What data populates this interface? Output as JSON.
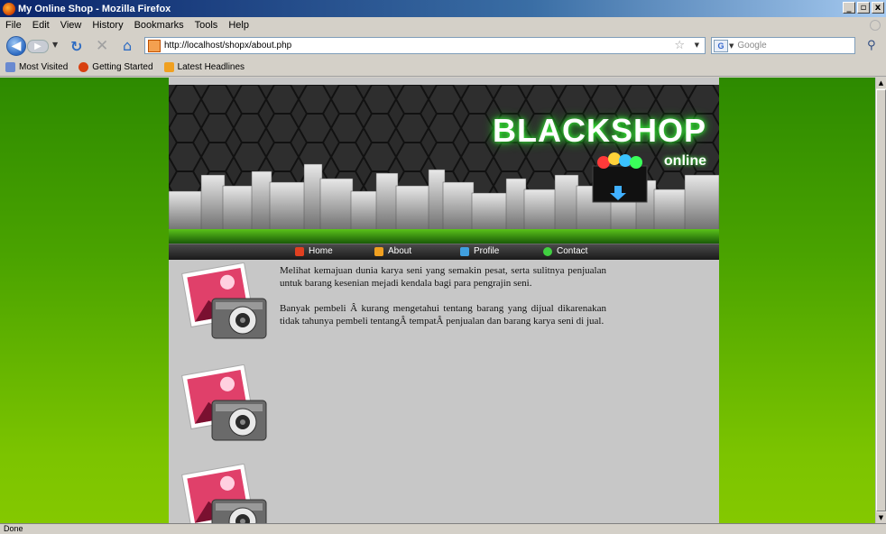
{
  "window": {
    "title": "My Online Shop - Mozilla Firefox",
    "controls": [
      "_",
      "▫",
      "x"
    ]
  },
  "menubar": [
    "File",
    "Edit",
    "View",
    "History",
    "Bookmarks",
    "Tools",
    "Help"
  ],
  "toolbar": {
    "url": "http://localhost/shopx/about.php",
    "search_placeholder": "Google",
    "search_engine": "G"
  },
  "bookmarks": [
    {
      "label": "Most Visited",
      "icon": "most-visited-icon",
      "color": "#6a8ad0"
    },
    {
      "label": "Getting Started",
      "icon": "firefox-icon",
      "color": "#d84010"
    },
    {
      "label": "Latest Headlines",
      "icon": "rss-icon",
      "color": "#f0a020"
    }
  ],
  "site": {
    "brand": "BLACKSHOP",
    "brand_sub": "online",
    "accent": "#3cff3c",
    "nav": [
      {
        "label": "Home",
        "icon": "home-icon",
        "color": "#e04020"
      },
      {
        "label": "About",
        "icon": "pencil-icon",
        "color": "#f0a020"
      },
      {
        "label": "Profile",
        "icon": "profile-icon",
        "color": "#40a0e0"
      },
      {
        "label": "Contact",
        "icon": "contact-icon",
        "color": "#40d040"
      }
    ],
    "paragraphs": [
      "Melihat kemajuan dunia karya seni yang semakin pesat, serta sulitnya penjualan untuk barang kesenian mejadi kendala bagi para pengrajin seni.",
      "Banyak pembeli Â kurang mengetahui tentang barang yang dijual dikarenakan tidak tahunya pembeli tentangÂ  tempatÂ  penjualan dan barang karya seni di jual."
    ]
  },
  "status": "Done"
}
